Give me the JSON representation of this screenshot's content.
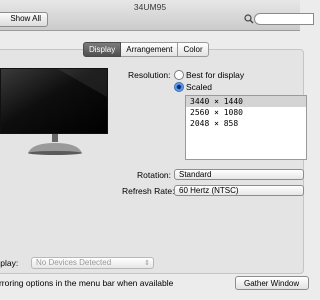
{
  "window": {
    "title": "34UM95"
  },
  "toolbar": {
    "show_all_label": "Show All",
    "search_value": "",
    "search_placeholder": ""
  },
  "tabs": [
    {
      "label": "Display",
      "active": true
    },
    {
      "label": "Arrangement",
      "active": false
    },
    {
      "label": "Color",
      "active": false
    }
  ],
  "display": {
    "resolution_label": "Resolution:",
    "option_best": "Best for display",
    "option_scaled": "Scaled",
    "selected_option": "Scaled",
    "resolutions": [
      "3440 × 1440",
      "2560 × 1080",
      "2048 × 858"
    ],
    "selected_resolution": "3440 × 1440",
    "rotation_label": "Rotation:",
    "rotation_value": "Standard",
    "refresh_label": "Refresh Rate:",
    "refresh_value": "60 Hertz (NTSC)"
  },
  "bottom": {
    "airplay_label": "Display:",
    "airplay_value": "No Devices Detected",
    "mirror_label": "mirroring options in the menu bar when available",
    "gather_label": "Gather Window"
  }
}
